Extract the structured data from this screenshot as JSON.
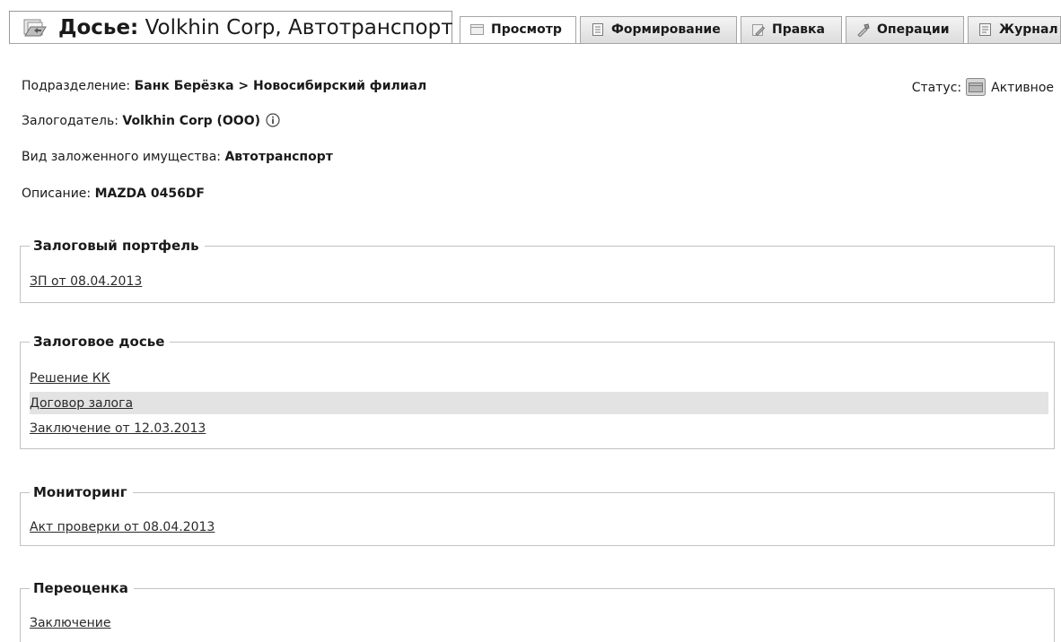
{
  "header": {
    "title_prefix": "Досье:",
    "title_rest": " Volkhin Corp, Автотранспорт",
    "tabs": [
      {
        "label": "Просмотр",
        "active": true
      },
      {
        "label": "Формирование",
        "active": false
      },
      {
        "label": "Правка",
        "active": false
      },
      {
        "label": "Операции",
        "active": false
      },
      {
        "label": "Журнал",
        "active": false
      }
    ]
  },
  "info": {
    "division": {
      "label": "Подразделение: ",
      "value": "Банк Берёзка > Новосибирский филиал"
    },
    "pledger": {
      "label": "Залогодатель: ",
      "value": "Volkhin Corp (ООО)"
    },
    "property_type": {
      "label": "Вид заложенного имущества: ",
      "value": "Автотранспорт"
    },
    "description": {
      "label": "Описание: ",
      "value": "MAZDA 0456DF"
    },
    "status": {
      "label": "Статус:",
      "value": "Активное"
    }
  },
  "groups": [
    {
      "title": "Залоговый портфель",
      "links": [
        "ЗП от 08.04.2013"
      ]
    },
    {
      "title": "Залоговое досье",
      "links": [
        "Решение КК",
        "Договор залога",
        "Заключение от 12.03.2013"
      ],
      "highlighted_index": 1
    },
    {
      "title": "Мониторинг",
      "links": [
        "Акт проверки от 08.04.2013"
      ]
    },
    {
      "title": "Переоценка",
      "links": [
        "Заключение"
      ]
    }
  ],
  "colors": {
    "border": "#c2c2c2",
    "tab_border": "#a5a5a5",
    "highlight_row": "#e3e3e3"
  },
  "icons": {
    "title": "dossier-folder-icon",
    "info": "info-circle-icon",
    "status": "status-folder-icon"
  }
}
